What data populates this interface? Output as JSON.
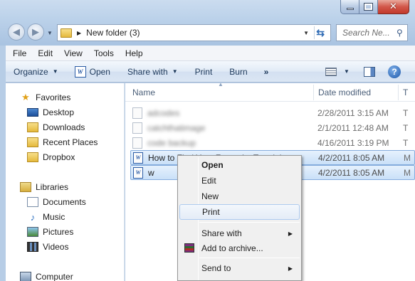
{
  "window": {
    "buttons": {
      "minimize": "minimize",
      "maximize": "maximize",
      "close": "✕"
    }
  },
  "navigation": {
    "back": "◀",
    "forward": "▶",
    "address": {
      "path": "New folder (3)"
    },
    "search": {
      "placeholder": "Search Ne..."
    }
  },
  "menubar": {
    "items": [
      "File",
      "Edit",
      "View",
      "Tools",
      "Help"
    ]
  },
  "commandbar": {
    "organize": "Organize",
    "open": "Open",
    "share_with": "Share with",
    "print": "Print",
    "burn": "Burn",
    "more": "»"
  },
  "navpane": {
    "favorites": "Favorites",
    "favorites_items": [
      "Desktop",
      "Downloads",
      "Recent Places",
      "Dropbox"
    ],
    "libraries": "Libraries",
    "libraries_items": [
      "Documents",
      "Music",
      "Pictures",
      "Videos"
    ],
    "computer": "Computer"
  },
  "filelist": {
    "columns": {
      "name": "Name",
      "date_modified": "Date modified",
      "type": "T"
    },
    "rows": [
      {
        "name": "adcodes",
        "date": "2/28/2011 3:15 AM",
        "type": "T",
        "blurred": true
      },
      {
        "name": "catchthatimage",
        "date": "2/1/2011 12:48 AM",
        "type": "T",
        "blurred": true
      },
      {
        "name": "code backup",
        "date": "4/16/2011 3:19 PM",
        "type": "T",
        "blurred": true
      },
      {
        "name": "How to Find Your Favourite Tutorials",
        "date": "4/2/2011 8:05 AM",
        "type": "M",
        "blurred": false,
        "selected": true
      },
      {
        "name": "w",
        "date": "4/2/2011 8:05 AM",
        "type": "M",
        "blurred": false,
        "selected": true
      }
    ]
  },
  "context_menu": {
    "open": "Open",
    "edit": "Edit",
    "new": "New",
    "print": "Print",
    "share_with": "Share with",
    "add_to_archive": "Add to archive...",
    "send_to": "Send to"
  }
}
